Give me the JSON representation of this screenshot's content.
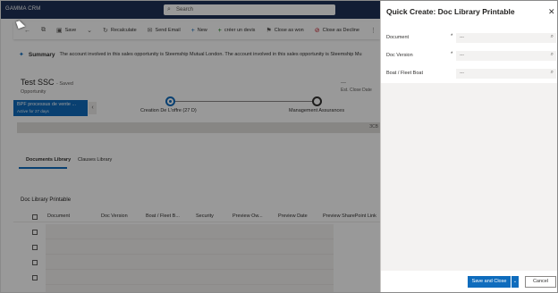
{
  "app": {
    "brand": "GAMMA CRM",
    "search_placeholder": "Search"
  },
  "command_bar": {
    "save": "Save",
    "recalculate": "Recalculate",
    "send_email": "Send Email",
    "new": "New",
    "create_quote": "créer un devis",
    "close_as_won": "Close as won",
    "close_as_decline": "Close as Decline"
  },
  "summary": {
    "title": "Summary",
    "text": "The account involved in this sales opportunity is Steemship Mutual London. The account involved in this sales opportunity is Steemship Mu"
  },
  "record": {
    "title": "Test SSC",
    "saved": "- Saved",
    "entity": "Opportunity",
    "header_value": "---",
    "header_label": "Est. Close Date"
  },
  "bpf": {
    "process_name": "BPF processus de vente ...",
    "active_for": "Active for 27 days",
    "stage_1": "Creation De L'offre  (27 D)",
    "stage_2": "Management Assurances"
  },
  "strip_text": "ЗСВ",
  "tabs": {
    "documents_library": "Documents Library",
    "clauses_library": "Clauses Library"
  },
  "grid": {
    "title": "Doc Library Printable",
    "columns": [
      "Document",
      "Doc Version",
      "Boat / Fleet B...",
      "Security",
      "Preview Ow...",
      "Preview Date",
      "Preview SharePoint Link"
    ]
  },
  "quick_create": {
    "title": "Quick Create: Doc Library Printable",
    "fields": [
      {
        "label": "Document",
        "required": "*",
        "placeholder": "---"
      },
      {
        "label": "Doc Version",
        "required": "*",
        "placeholder": "---"
      },
      {
        "label": "Boat / Fleet Boat",
        "required": "",
        "placeholder": "---"
      }
    ],
    "save_and_close": "Save and Close",
    "split_chevron": "⌄",
    "cancel": "Cancel"
  }
}
